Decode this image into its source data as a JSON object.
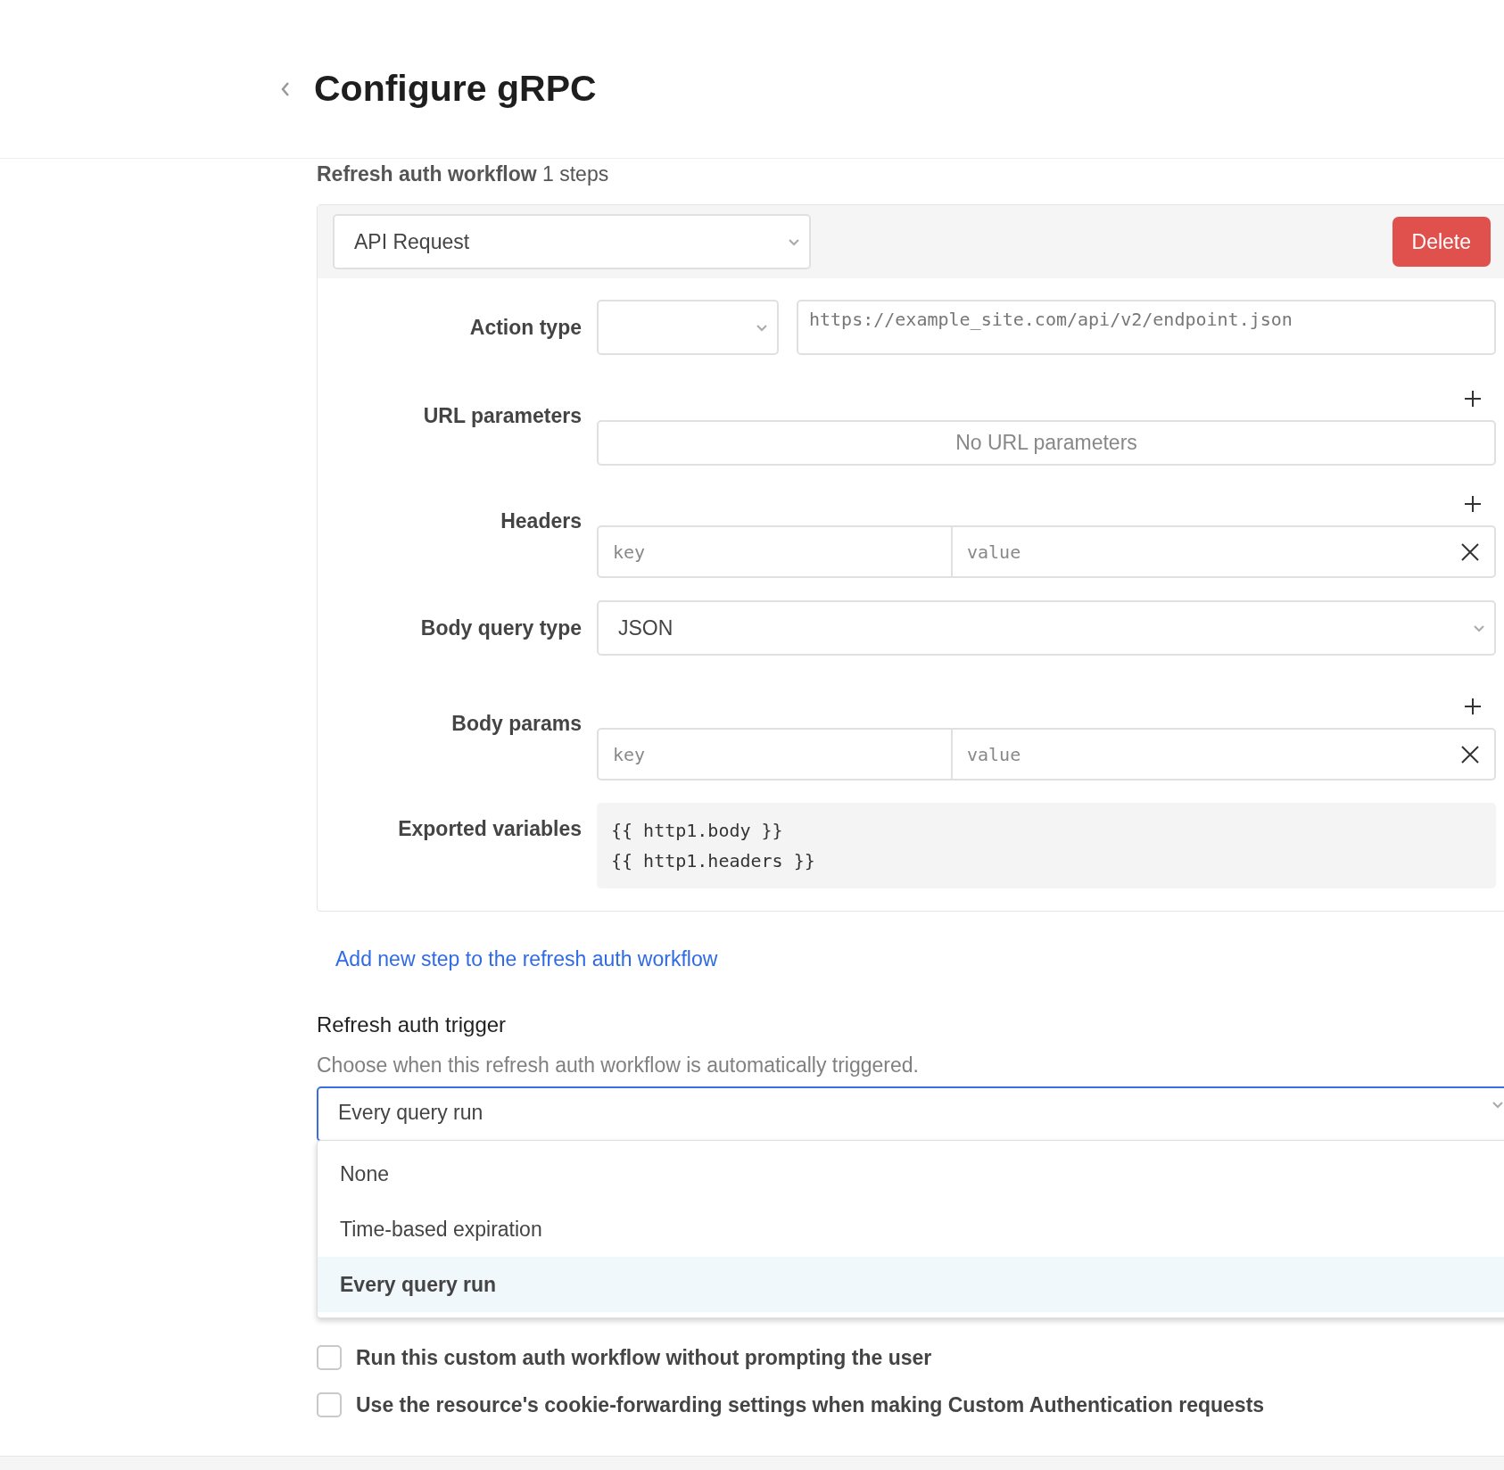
{
  "header": {
    "title": "Configure gRPC"
  },
  "workflow": {
    "title": "**Refresh auth workflow** 1 steps",
    "steps": [
      {
        "step_type": "API Request",
        "delete_label": "Delete",
        "fields": [
          {
            "kind": "action",
            "label": "Action type",
            "url_placeholder": "https://example_site.com/api/v2/endpoint.json"
          },
          {
            "kind": "empty_list",
            "label": "URL parameters",
            "empty_text": "No URL parameters"
          },
          {
            "kind": "key_value",
            "label": "Headers",
            "key_placeholder": "key",
            "value_placeholder": "value"
          },
          {
            "kind": "select",
            "label": "Body query type",
            "value": "JSON"
          },
          {
            "kind": "key_value",
            "label": "Body params",
            "key_placeholder": "key",
            "value_placeholder": "value"
          },
          {
            "kind": "code",
            "label": "Exported variables",
            "lines": [
              "{{ http1.body }}",
              "{{ http1.headers }}"
            ]
          }
        ]
      }
    ],
    "add_step_link": "Add new step to the refresh auth workflow"
  },
  "trigger": {
    "heading": "Refresh auth trigger",
    "description": "Choose when this refresh auth workflow is automatically triggered.",
    "value": "Every query run",
    "expanded": true,
    "options": [
      {
        "label": "None",
        "selected": false
      },
      {
        "label": "Time-based expiration",
        "selected": false
      },
      {
        "label": "Every query run",
        "selected": true
      }
    ]
  },
  "checkboxes": [
    {
      "label": "Run this custom auth workflow without prompting the user",
      "checked": false
    },
    {
      "label": "Use the resource's cookie-forwarding settings when making Custom Authentication requests",
      "checked": false
    }
  ]
}
